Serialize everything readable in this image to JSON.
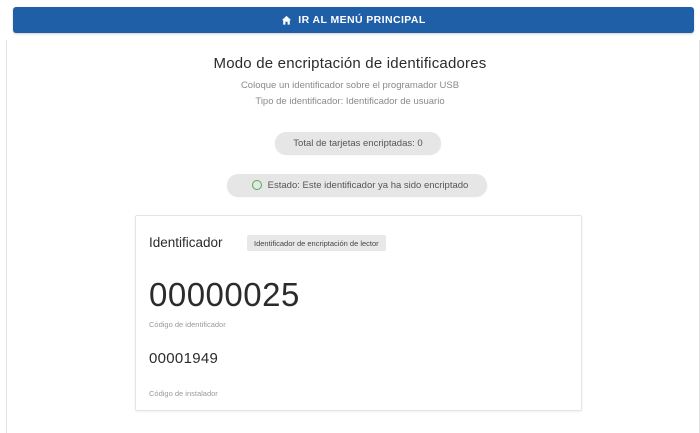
{
  "header": {
    "home_label": "IR AL MENÚ PRINCIPAL",
    "icon": "home-icon",
    "color": "#1f5fa8"
  },
  "main": {
    "title": "Modo de encriptación de identificadores",
    "instruction": "Coloque un identificador sobre el programador USB",
    "identifier_type": "Tipo de identificador: Identificador de usuario",
    "total_encrypted": "Total de tarjetas encriptadas: 0",
    "status": "Estado: Este identificador ya ha sido encriptado",
    "status_color": "#4caf50"
  },
  "card": {
    "label": "Identificador",
    "badge": "Identificador de encriptación de lector",
    "identifier_code": "00000025",
    "identifier_caption": "Código de identificador",
    "installer_code": "00001949",
    "installer_caption": "Código de instalador"
  }
}
